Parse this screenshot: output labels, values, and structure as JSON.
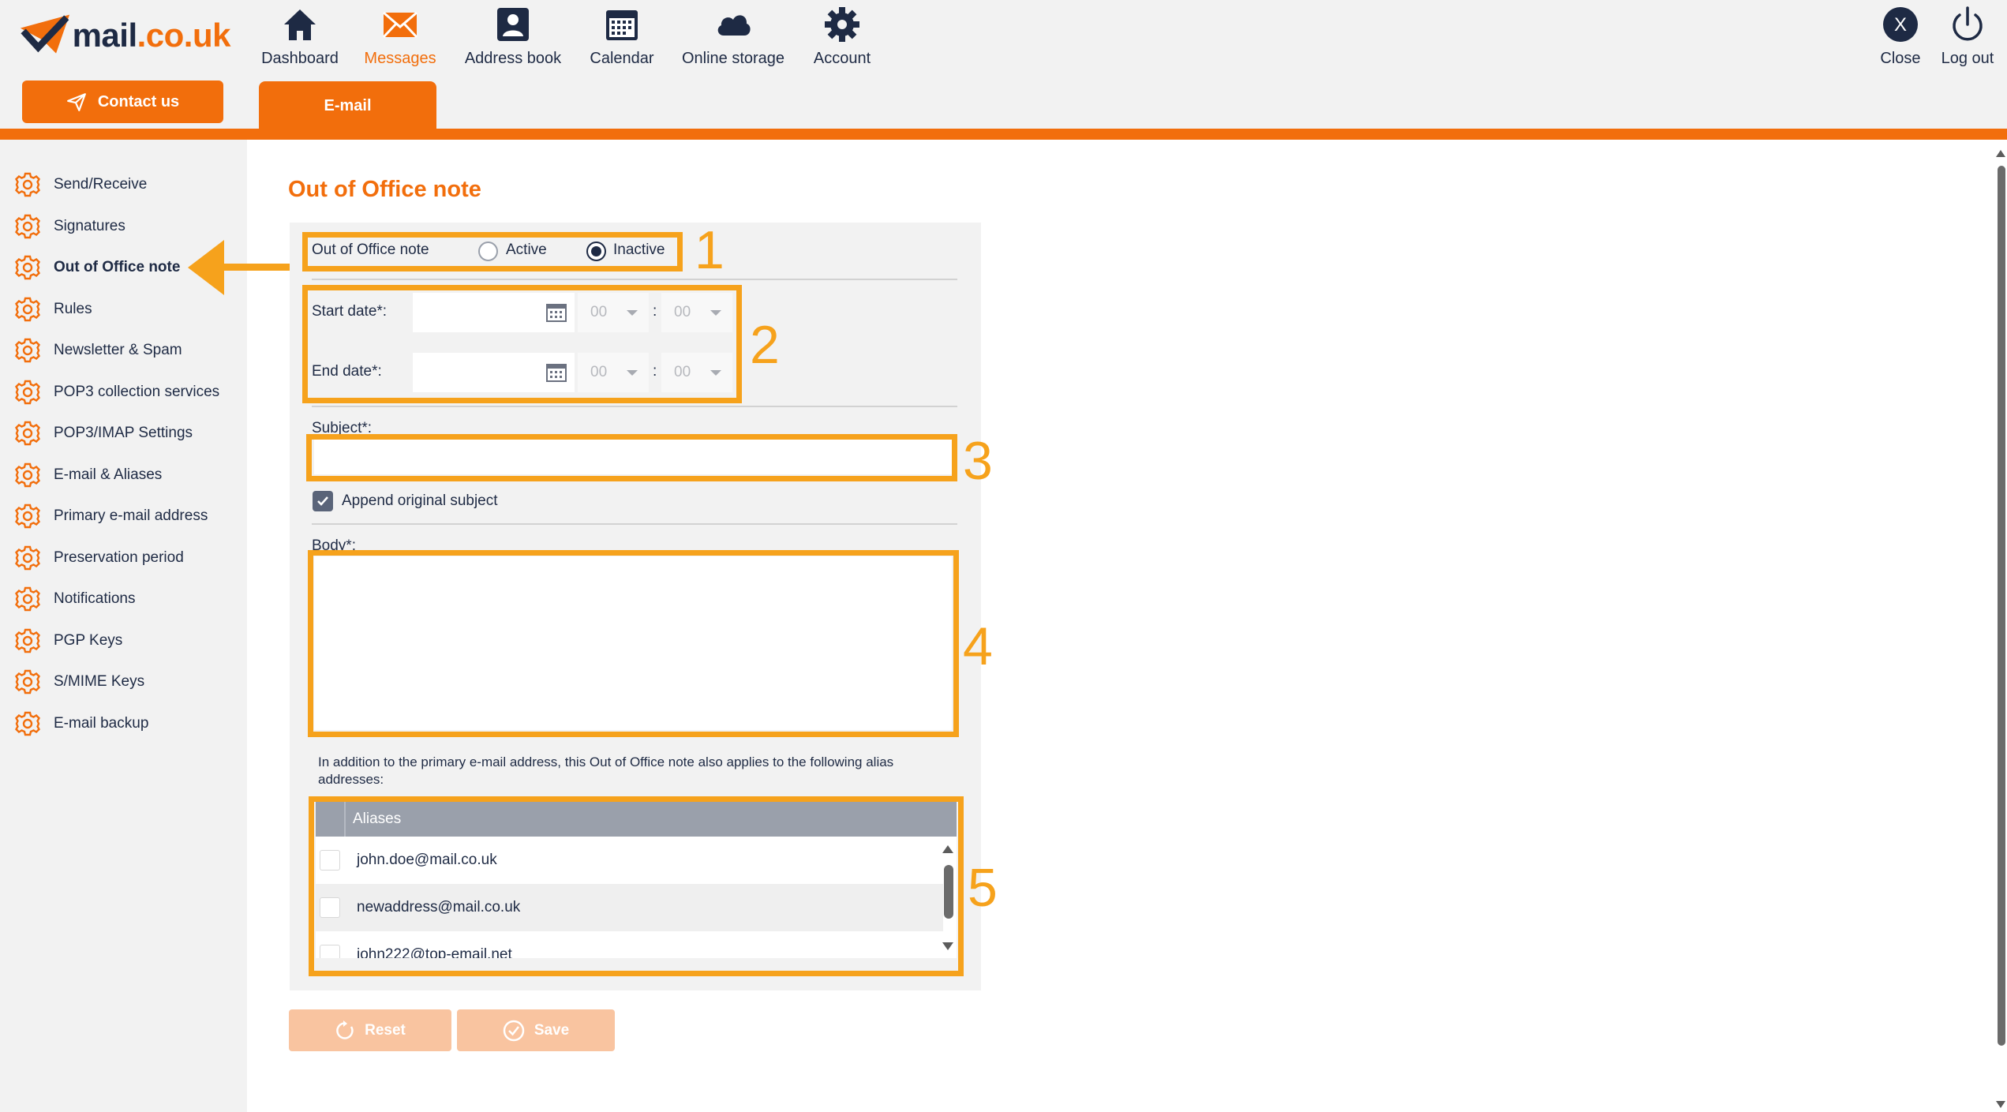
{
  "brand": {
    "logo_text_main": "mail",
    "logo_text_tld": ".co.uk",
    "accent_color": "#f26e0c",
    "annotation_color": "#f6a21c"
  },
  "header": {
    "contact_label": "Contact us",
    "nav": [
      {
        "label": "Dashboard",
        "icon": "home-icon"
      },
      {
        "label": "Messages",
        "icon": "envelope-icon"
      },
      {
        "label": "Address book",
        "icon": "contact-card-icon"
      },
      {
        "label": "Calendar",
        "icon": "calendar-icon"
      },
      {
        "label": "Online storage",
        "icon": "cloud-icon"
      },
      {
        "label": "Account",
        "icon": "gear-icon"
      }
    ],
    "close_label": "Close",
    "close_glyph": "X",
    "logout_label": "Log out",
    "email_tab_label": "E-mail"
  },
  "sidebar": {
    "items": [
      {
        "label": "Send/Receive"
      },
      {
        "label": "Signatures"
      },
      {
        "label": "Out of Office note"
      },
      {
        "label": "Rules"
      },
      {
        "label": "Newsletter & Spam"
      },
      {
        "label": "POP3 collection services"
      },
      {
        "label": "POP3/IMAP Settings"
      },
      {
        "label": "E-mail & Aliases"
      },
      {
        "label": "Primary e-mail address"
      },
      {
        "label": "Preservation period"
      },
      {
        "label": "Notifications"
      },
      {
        "label": "PGP Keys"
      },
      {
        "label": "S/MIME Keys"
      },
      {
        "label": "E-mail backup"
      }
    ],
    "active_index": 2
  },
  "main": {
    "title": "Out of Office note",
    "status": {
      "label": "Out of Office note",
      "active_label": "Active",
      "inactive_label": "Inactive",
      "selected": "Inactive"
    },
    "start_date": {
      "label": "Start date*:",
      "value": "",
      "hour": "00",
      "minute": "00",
      "separator": ":"
    },
    "end_date": {
      "label": "End date*:",
      "value": "",
      "hour": "00",
      "minute": "00",
      "separator": ":"
    },
    "subject": {
      "label": "Subject*:",
      "value": ""
    },
    "append_subject": {
      "label": "Append original subject",
      "checked": true
    },
    "body": {
      "label": "Body*:",
      "value": ""
    },
    "alias_info": "In addition to the primary e-mail address, this Out of Office note also applies to the following alias addresses:",
    "aliases": {
      "header": "Aliases",
      "rows": [
        "john.doe@mail.co.uk",
        "newaddress@mail.co.uk",
        "john222@top-email.net"
      ]
    },
    "reset_label": "Reset",
    "save_label": "Save"
  },
  "annotations": [
    "1",
    "2",
    "3",
    "4",
    "5"
  ]
}
